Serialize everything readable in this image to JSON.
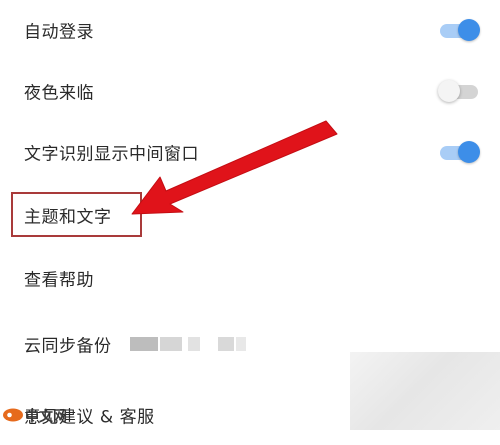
{
  "settings": {
    "auto_login": {
      "label": "自动登录",
      "enabled": true
    },
    "night_mode": {
      "label": "夜色来临",
      "enabled": false
    },
    "ocr_middle_window": {
      "label": "文字识别显示中间窗口",
      "enabled": true
    },
    "theme_and_text": {
      "label": "主题和文字"
    },
    "view_help": {
      "label": "查看帮助"
    },
    "cloud_backup": {
      "label": "云同步备份"
    },
    "feedback": {
      "label": "意见建议 & 客服"
    }
  },
  "watermark": {
    "text": "中文网"
  },
  "colors": {
    "toggle_on": "#3d8ee8",
    "toggle_off": "#f4f4f4",
    "highlight_border": "#a93a3a",
    "arrow": "#e0131a"
  },
  "icons": {
    "annotation_arrow": "red-arrow-icon",
    "watermark_logo": "php-logo-icon"
  }
}
